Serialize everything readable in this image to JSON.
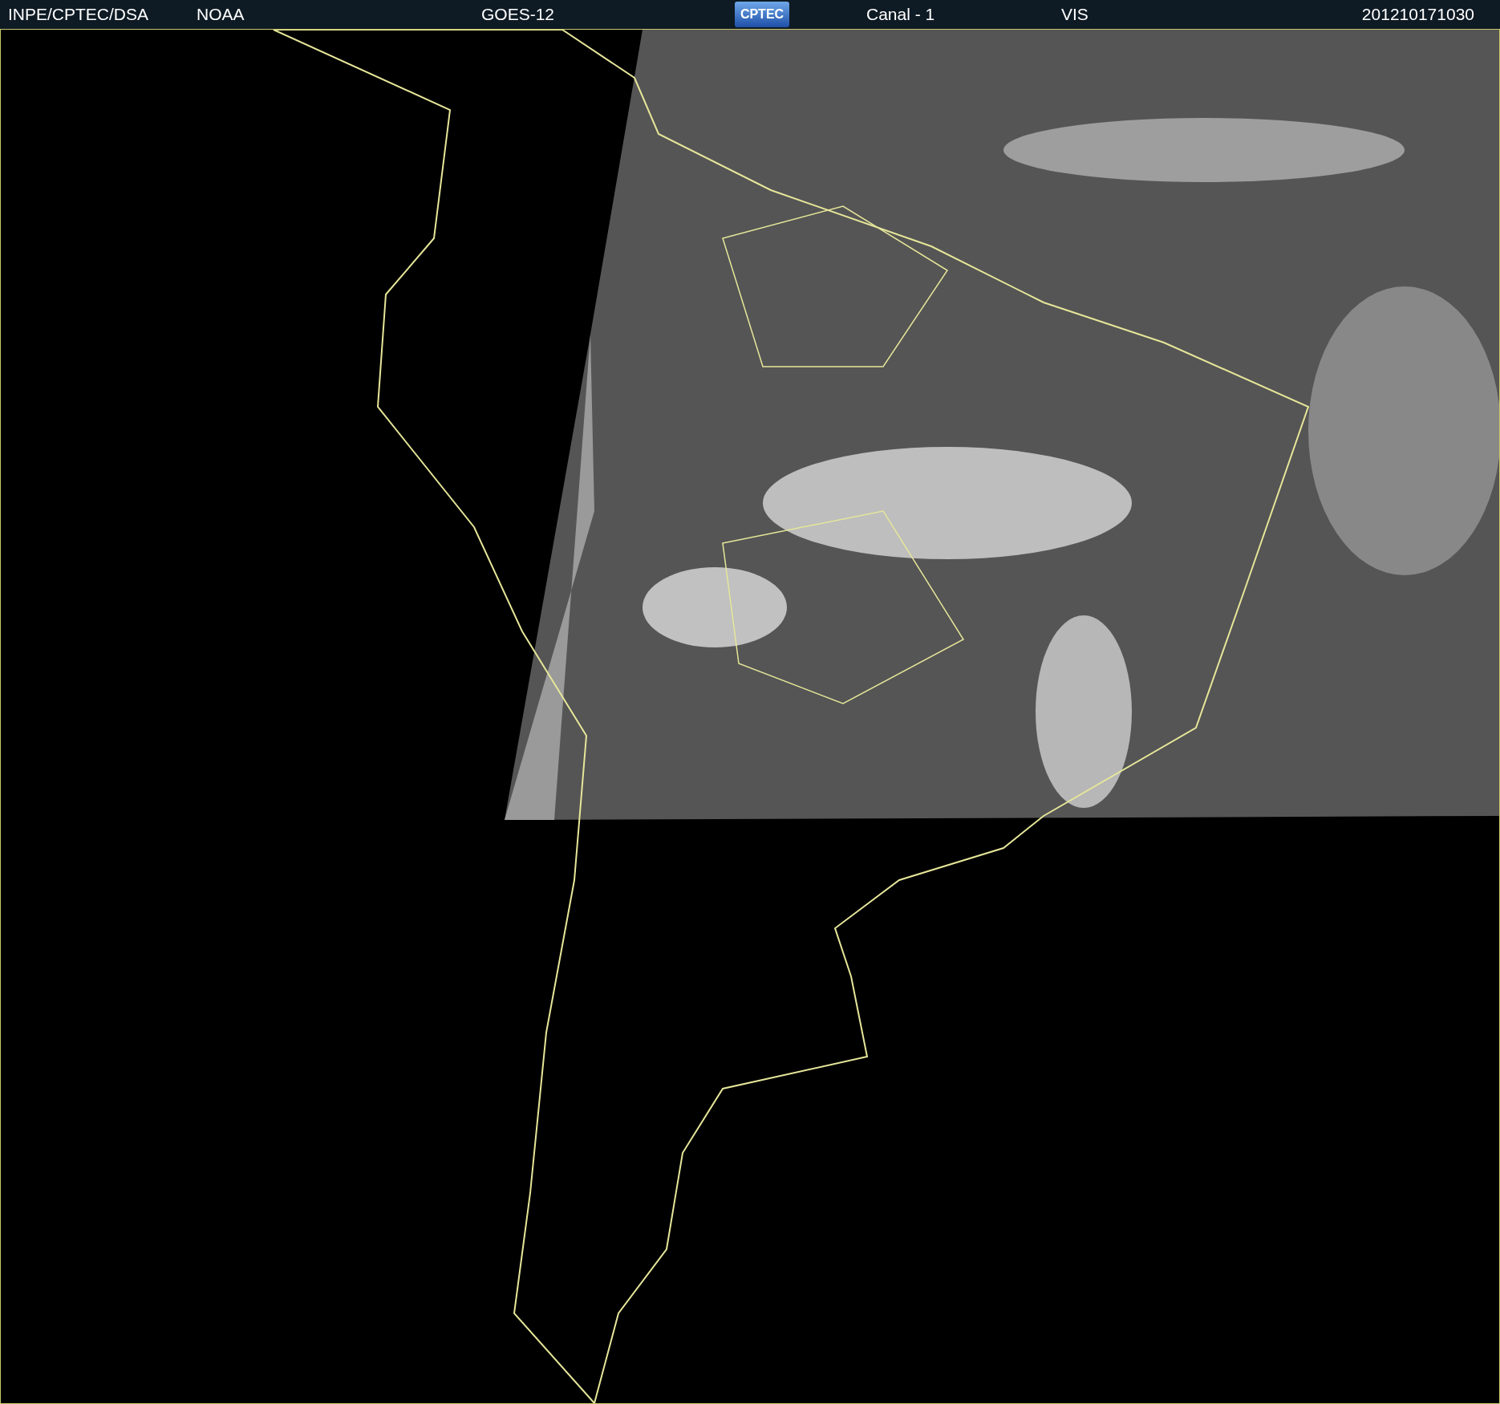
{
  "header": {
    "source": "INPE/CPTEC/DSA",
    "agency": "NOAA",
    "satellite": "GOES-12",
    "logo": "CPTEC",
    "channel": "Canal - 1",
    "band": "VIS",
    "timestamp": "201210171030"
  }
}
